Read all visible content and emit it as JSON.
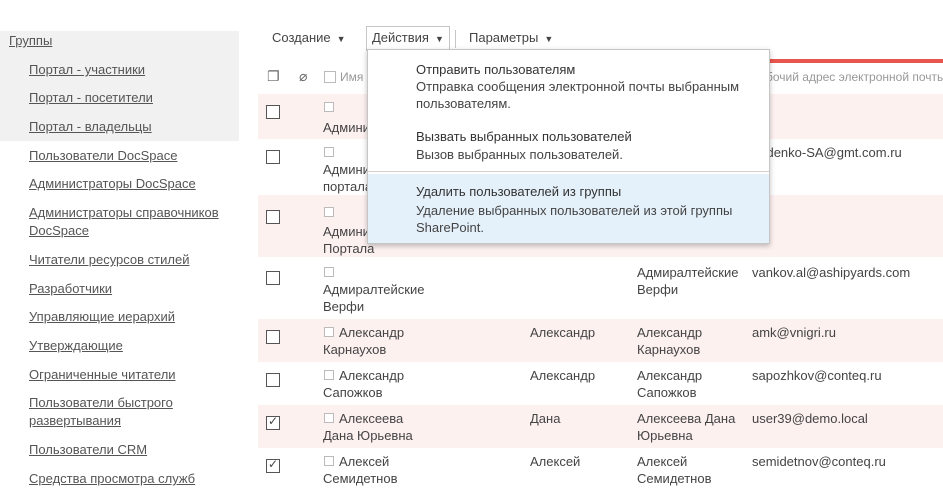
{
  "nav": {
    "root": "Группы",
    "items": [
      "Портал - участники",
      "Портал - посетители",
      "Портал - владельцы",
      "Пользователи DocSpace",
      "Администраторы DocSpace",
      "Администраторы справочников DocSpace",
      "Читатели ресурсов стилей",
      "Разработчики",
      "Управляющие иерархий",
      "Утверждающие",
      "Ограниченные читатели",
      "Пользователи быстрого развертывания",
      "Пользователи CRM",
      "Средства просмотра служб"
    ]
  },
  "toolbar": {
    "create": "Создание",
    "actions": "Действия",
    "params": "Параметры"
  },
  "header": {
    "name": "Имя",
    "email": "бочий адрес электронной почты"
  },
  "menu": {
    "items": [
      {
        "title": "Отправить пользователям",
        "desc": "Отправка сообщения электронной почты выбранным пользователям."
      },
      {
        "title": "Вызвать выбранных пользователей",
        "desc": "Вызов выбранных пользователей."
      },
      {
        "title": "Удалить пользователей из группы",
        "desc": "Удаление выбранных пользователей из этой группы SharePoint."
      }
    ]
  },
  "rows": [
    {
      "name_l1": "",
      "name_l2": "Админи",
      "name_l3": "",
      "first": "",
      "disp_l1": "",
      "disp_l2": "",
      "email": "",
      "checked": false
    },
    {
      "name_l1": "",
      "name_l2": "Админи",
      "name_l3": "портала",
      "first": "",
      "disp_l1": "",
      "disp_l2": "",
      "email": "bedenko-SA@gmt.com.ru",
      "checked": false
    },
    {
      "name_l1": "",
      "name_l2": "Админи",
      "name_l3": "Портала",
      "first": "",
      "disp_l1": "",
      "disp_l2": "",
      "email": "",
      "checked": false
    },
    {
      "name_l1": "",
      "name_l2": "Адмиралтейские",
      "name_l3": "Верфи",
      "first": "",
      "disp_l1": "Адмиралтейские",
      "disp_l2": "Верфи",
      "email": "vankov.al@ashipyards.com",
      "checked": false
    },
    {
      "name_l1": "Александр",
      "name_l2": "Карнаухов",
      "name_l3": "",
      "first": "Александр",
      "disp_l1": "Александр",
      "disp_l2": "Карнаухов",
      "email": "amk@vnigri.ru",
      "checked": false
    },
    {
      "name_l1": "Александр",
      "name_l2": "Сапожков",
      "name_l3": "",
      "first": "Александр",
      "disp_l1": "Александр",
      "disp_l2": "Сапожков",
      "email": "sapozhkov@conteq.ru",
      "checked": false
    },
    {
      "name_l1": "Алексеева",
      "name_l2": "Дана Юрьевна",
      "name_l3": "",
      "first": "Дана",
      "disp_l1": "Алексеева Дана",
      "disp_l2": "Юрьевна",
      "email": "user39@demo.local",
      "checked": true
    },
    {
      "name_l1": "Алексей",
      "name_l2": "Семидетнов",
      "name_l3": "",
      "first": "Алексей",
      "disp_l1": "Алексей",
      "disp_l2": "Семидетнов",
      "email": "semidetnov@conteq.ru",
      "checked": true
    }
  ],
  "colors": {
    "accent_red": "#e8554e",
    "menu_highlight": "#e5f1fa",
    "row_pink": "#fdf1f0"
  }
}
